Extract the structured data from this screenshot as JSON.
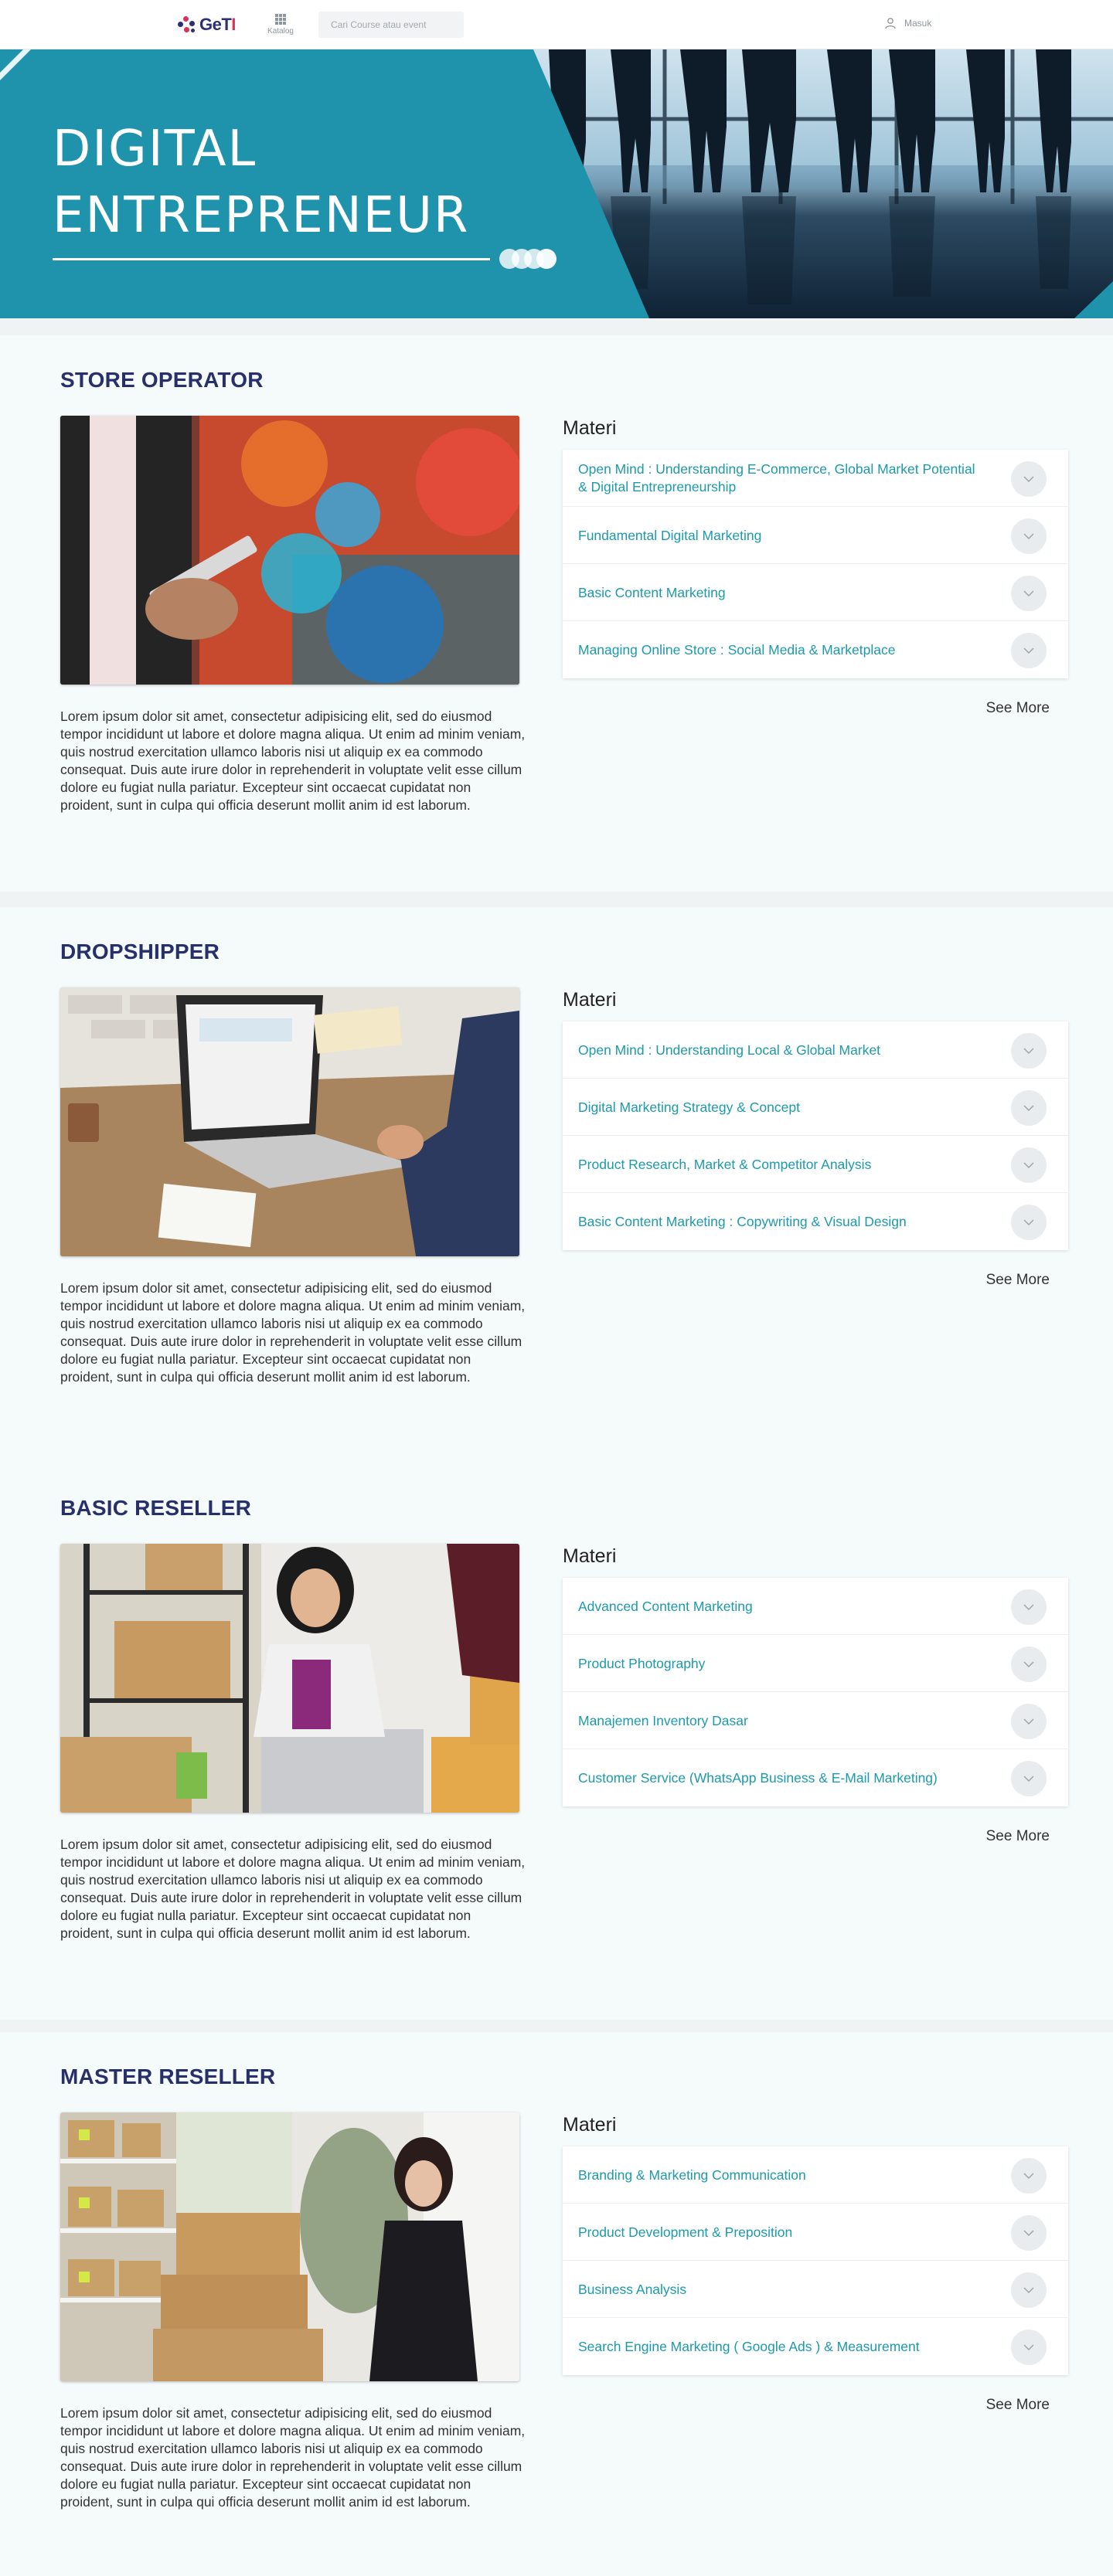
{
  "header": {
    "logo": {
      "text_main": "GeT",
      "text_accent": "I"
    },
    "katalog_label": "Katalog",
    "search_placeholder": "Cari Course atau event",
    "login_label": "Masuk"
  },
  "hero": {
    "title_line1": "DIGITAL",
    "title_line2": "ENTREPRENEUR",
    "colors": {
      "band": "#1e93ab",
      "band_dark": "#157a91"
    }
  },
  "colors": {
    "heading": "#27306b",
    "accent": "#1c9aad"
  },
  "sections": [
    {
      "title": "STORE OPERATOR",
      "image_icon": "business-touchscreen-image",
      "materi_heading": "Materi",
      "items": [
        "Open Mind : Understanding E-Commerce, Global Market Potential & Digital Entrepreneurship",
        "Fundamental Digital Marketing",
        "Basic Content Marketing",
        "Managing Online Store : Social Media & Marketplace"
      ],
      "description": "Lorem ipsum dolor sit amet, consectetur adipisicing elit, sed do eiusmod tempor incididunt ut labore et dolore magna aliqua. Ut enim ad minim veniam, quis nostrud exercitation ullamco laboris nisi ut aliquip ex ea commodo consequat. Duis aute irure dolor in reprehenderit in voluptate velit esse cillum dolore eu fugiat nulla pariatur. Excepteur sint occaecat cupidatat non proident, sunt in culpa qui officia deserunt mollit anim id est laborum.",
      "see_more": "See More"
    },
    {
      "title": "DROPSHIPPER",
      "image_icon": "laptop-desk-image",
      "materi_heading": "Materi",
      "items": [
        "Open Mind : Understanding Local & Global Market",
        "Digital Marketing Strategy & Concept",
        "Product Research, Market & Competitor Analysis",
        "Basic Content Marketing : Copywriting & Visual Design"
      ],
      "description": "Lorem ipsum dolor sit amet, consectetur adipisicing elit, sed do eiusmod tempor incididunt ut labore et dolore magna aliqua. Ut enim ad minim veniam, quis nostrud exercitation ullamco laboris nisi ut aliquip ex ea commodo consequat. Duis aute irure dolor in reprehenderit in voluptate velit esse cillum dolore eu fugiat nulla pariatur. Excepteur sint occaecat cupidatat non proident, sunt in culpa qui officia deserunt mollit anim id est laborum.",
      "see_more": "See More"
    },
    {
      "title": "BASIC RESELLER",
      "image_icon": "reseller-phone-boxes-image",
      "materi_heading": "Materi",
      "items": [
        "Advanced Content Marketing",
        "Product Photography",
        "Manajemen Inventory Dasar",
        "Customer Service (WhatsApp Business & E-Mail Marketing)"
      ],
      "description": "Lorem ipsum dolor sit amet, consectetur adipisicing elit, sed do eiusmod tempor incididunt ut labore et dolore magna aliqua. Ut enim ad minim veniam, quis nostrud exercitation ullamco laboris nisi ut aliquip ex ea commodo consequat. Duis aute irure dolor in reprehenderit in voluptate velit esse cillum dolore eu fugiat nulla pariatur. Excepteur sint occaecat cupidatat non proident, sunt in culpa qui officia deserunt mollit anim id est laborum.",
      "see_more": "See More"
    },
    {
      "title": "MASTER RESELLER",
      "image_icon": "warehouse-phone-image",
      "materi_heading": "Materi",
      "items": [
        "Branding & Marketing Communication",
        "Product Development & Preposition",
        "Business Analysis",
        "Search Engine Marketing ( Google Ads ) & Measurement"
      ],
      "description": "Lorem ipsum dolor sit amet, consectetur adipisicing elit, sed do eiusmod tempor incididunt ut labore et dolore magna aliqua. Ut enim ad minim veniam, quis nostrud exercitation ullamco laboris nisi ut aliquip ex ea commodo consequat. Duis aute irure dolor in reprehenderit in voluptate velit esse cillum dolore eu fugiat nulla pariatur. Excepteur sint occaecat cupidatat non proident, sunt in culpa qui officia deserunt mollit anim id est laborum.",
      "see_more": "See More"
    }
  ]
}
